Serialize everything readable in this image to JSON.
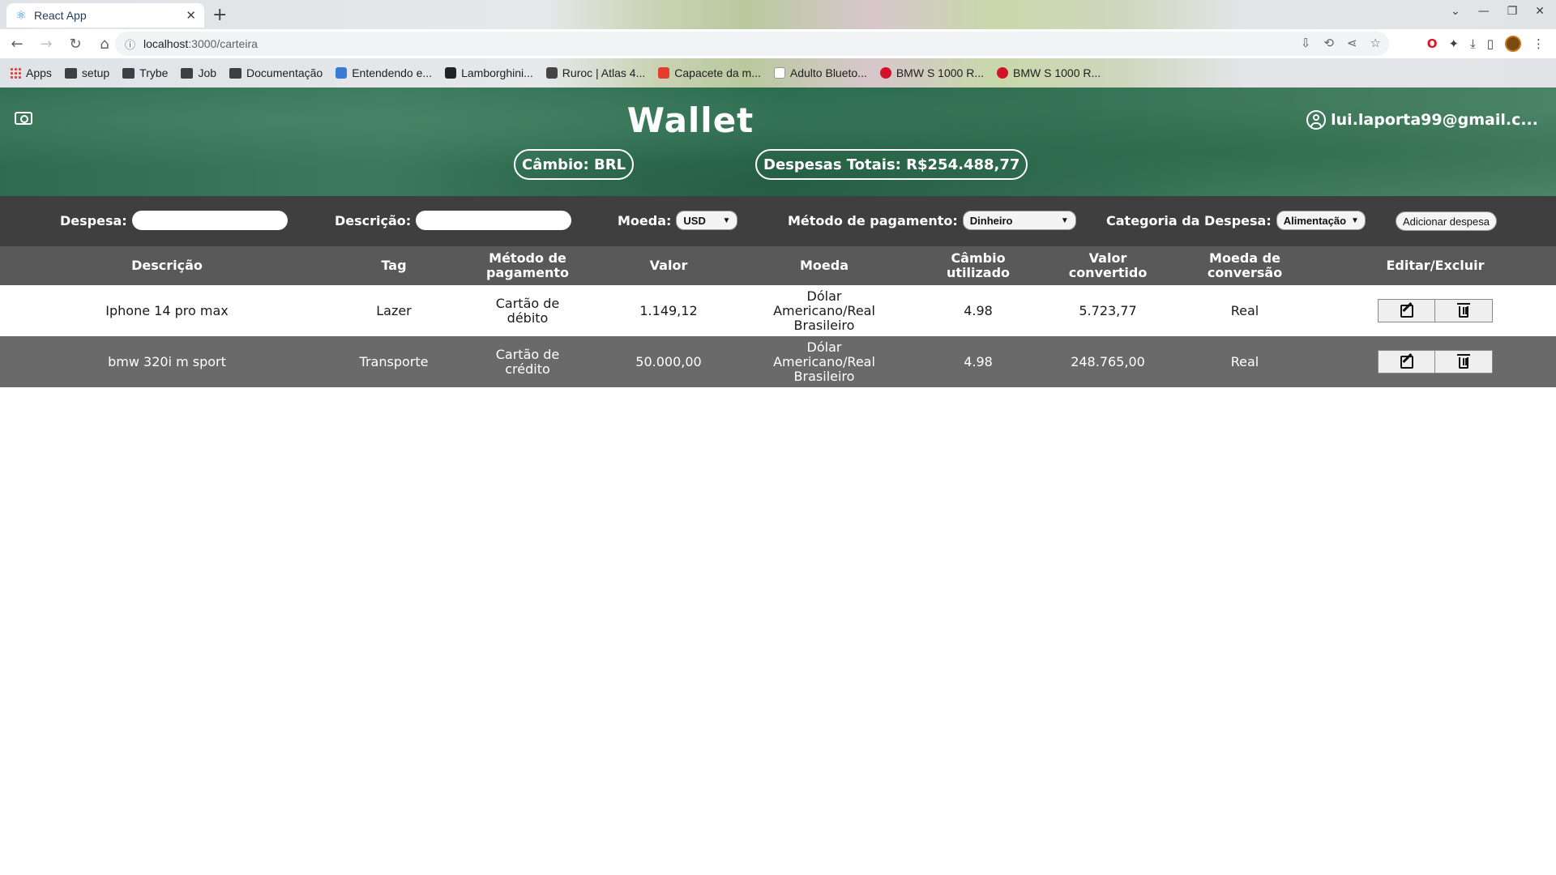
{
  "browser": {
    "tab_title": "React App",
    "url_host": "localhost",
    "url_path": ":3000/carteira",
    "bookmarks": [
      "Apps",
      "setup",
      "Trybe",
      "Job",
      "Documentação",
      "Entendendo e...",
      "Lamborghini...",
      "Ruroc | Atlas 4...",
      "Capacete da m...",
      "Adulto Blueto...",
      "BMW S 1000 R...",
      "BMW S 1000 R..."
    ]
  },
  "header": {
    "title": "Wallet",
    "user_email": "lui.laporta99@gmail.c...",
    "cambio_label": "Câmbio: BRL",
    "total_label": "Despesas Totais: R$254.488,77"
  },
  "form": {
    "despesa_label": "Despesa:",
    "despesa_value": "",
    "descricao_label": "Descrição:",
    "descricao_value": "",
    "moeda_label": "Moeda:",
    "moeda_value": "USD",
    "metodo_label": "Método de pagamento:",
    "metodo_value": "Dinheiro",
    "categoria_label": "Categoria da Despesa:",
    "categoria_value": "Alimentação",
    "add_button": "Adicionar despesa"
  },
  "table": {
    "headers": [
      "Descrição",
      "Tag",
      "Método de pagamento",
      "Valor",
      "Moeda",
      "Câmbio utilizado",
      "Valor convertido",
      "Moeda de conversão",
      "Editar/Excluir"
    ],
    "rows": [
      [
        "Iphone 14 pro max",
        "Lazer",
        "Cartão de débito",
        "1.149,12",
        "Dólar Americano/Real Brasileiro",
        "4.98",
        "5.723,77",
        "Real"
      ],
      [
        "bmw 320i m sport",
        "Transporte",
        "Cartão de crédito",
        "50.000,00",
        "Dólar Americano/Real Brasileiro",
        "4.98",
        "248.765,00",
        "Real"
      ]
    ]
  },
  "colors": {
    "header_green": "#2f6b50",
    "form_bar": "#3f3f3f",
    "table_header": "#595959",
    "row_dark": "#6a6a6a"
  }
}
